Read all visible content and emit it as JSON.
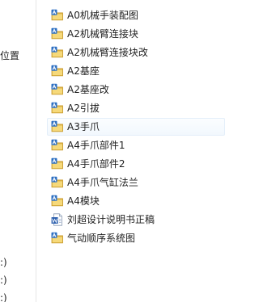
{
  "nav_pane": {
    "items": [
      ":)",
      "位置",
      ":)",
      ":)"
    ]
  },
  "file_list": {
    "items": [
      {
        "name": "A0机械手装配图",
        "icon": "folder-assembly-icon"
      },
      {
        "name": "A2机械臂连接块",
        "icon": "folder-assembly-icon"
      },
      {
        "name": "A2机械臂连接块改",
        "icon": "folder-assembly-icon"
      },
      {
        "name": "A2基座",
        "icon": "folder-assembly-icon"
      },
      {
        "name": "A2基座改",
        "icon": "folder-assembly-icon"
      },
      {
        "name": "A2引拔",
        "icon": "folder-assembly-icon"
      },
      {
        "name": "A3手爪",
        "icon": "folder-assembly-icon",
        "hovered": true
      },
      {
        "name": "A4手爪部件1",
        "icon": "folder-assembly-icon"
      },
      {
        "name": "A4手爪部件2",
        "icon": "folder-assembly-icon"
      },
      {
        "name": "A4手爪气缸法兰",
        "icon": "folder-assembly-icon"
      },
      {
        "name": "A4模块",
        "icon": "folder-assembly-icon"
      },
      {
        "name": "刘超设计说明书正稿",
        "icon": "word-document-icon"
      },
      {
        "name": "气动顺序系统图",
        "icon": "folder-assembly-icon"
      }
    ]
  },
  "colors": {
    "folder": "#e9c25a",
    "folder_dark": "#c99a2a",
    "overlay_blue": "#2d6fc2",
    "hover_bg": "#f2f8fd",
    "hover_border": "#e3eef9"
  }
}
